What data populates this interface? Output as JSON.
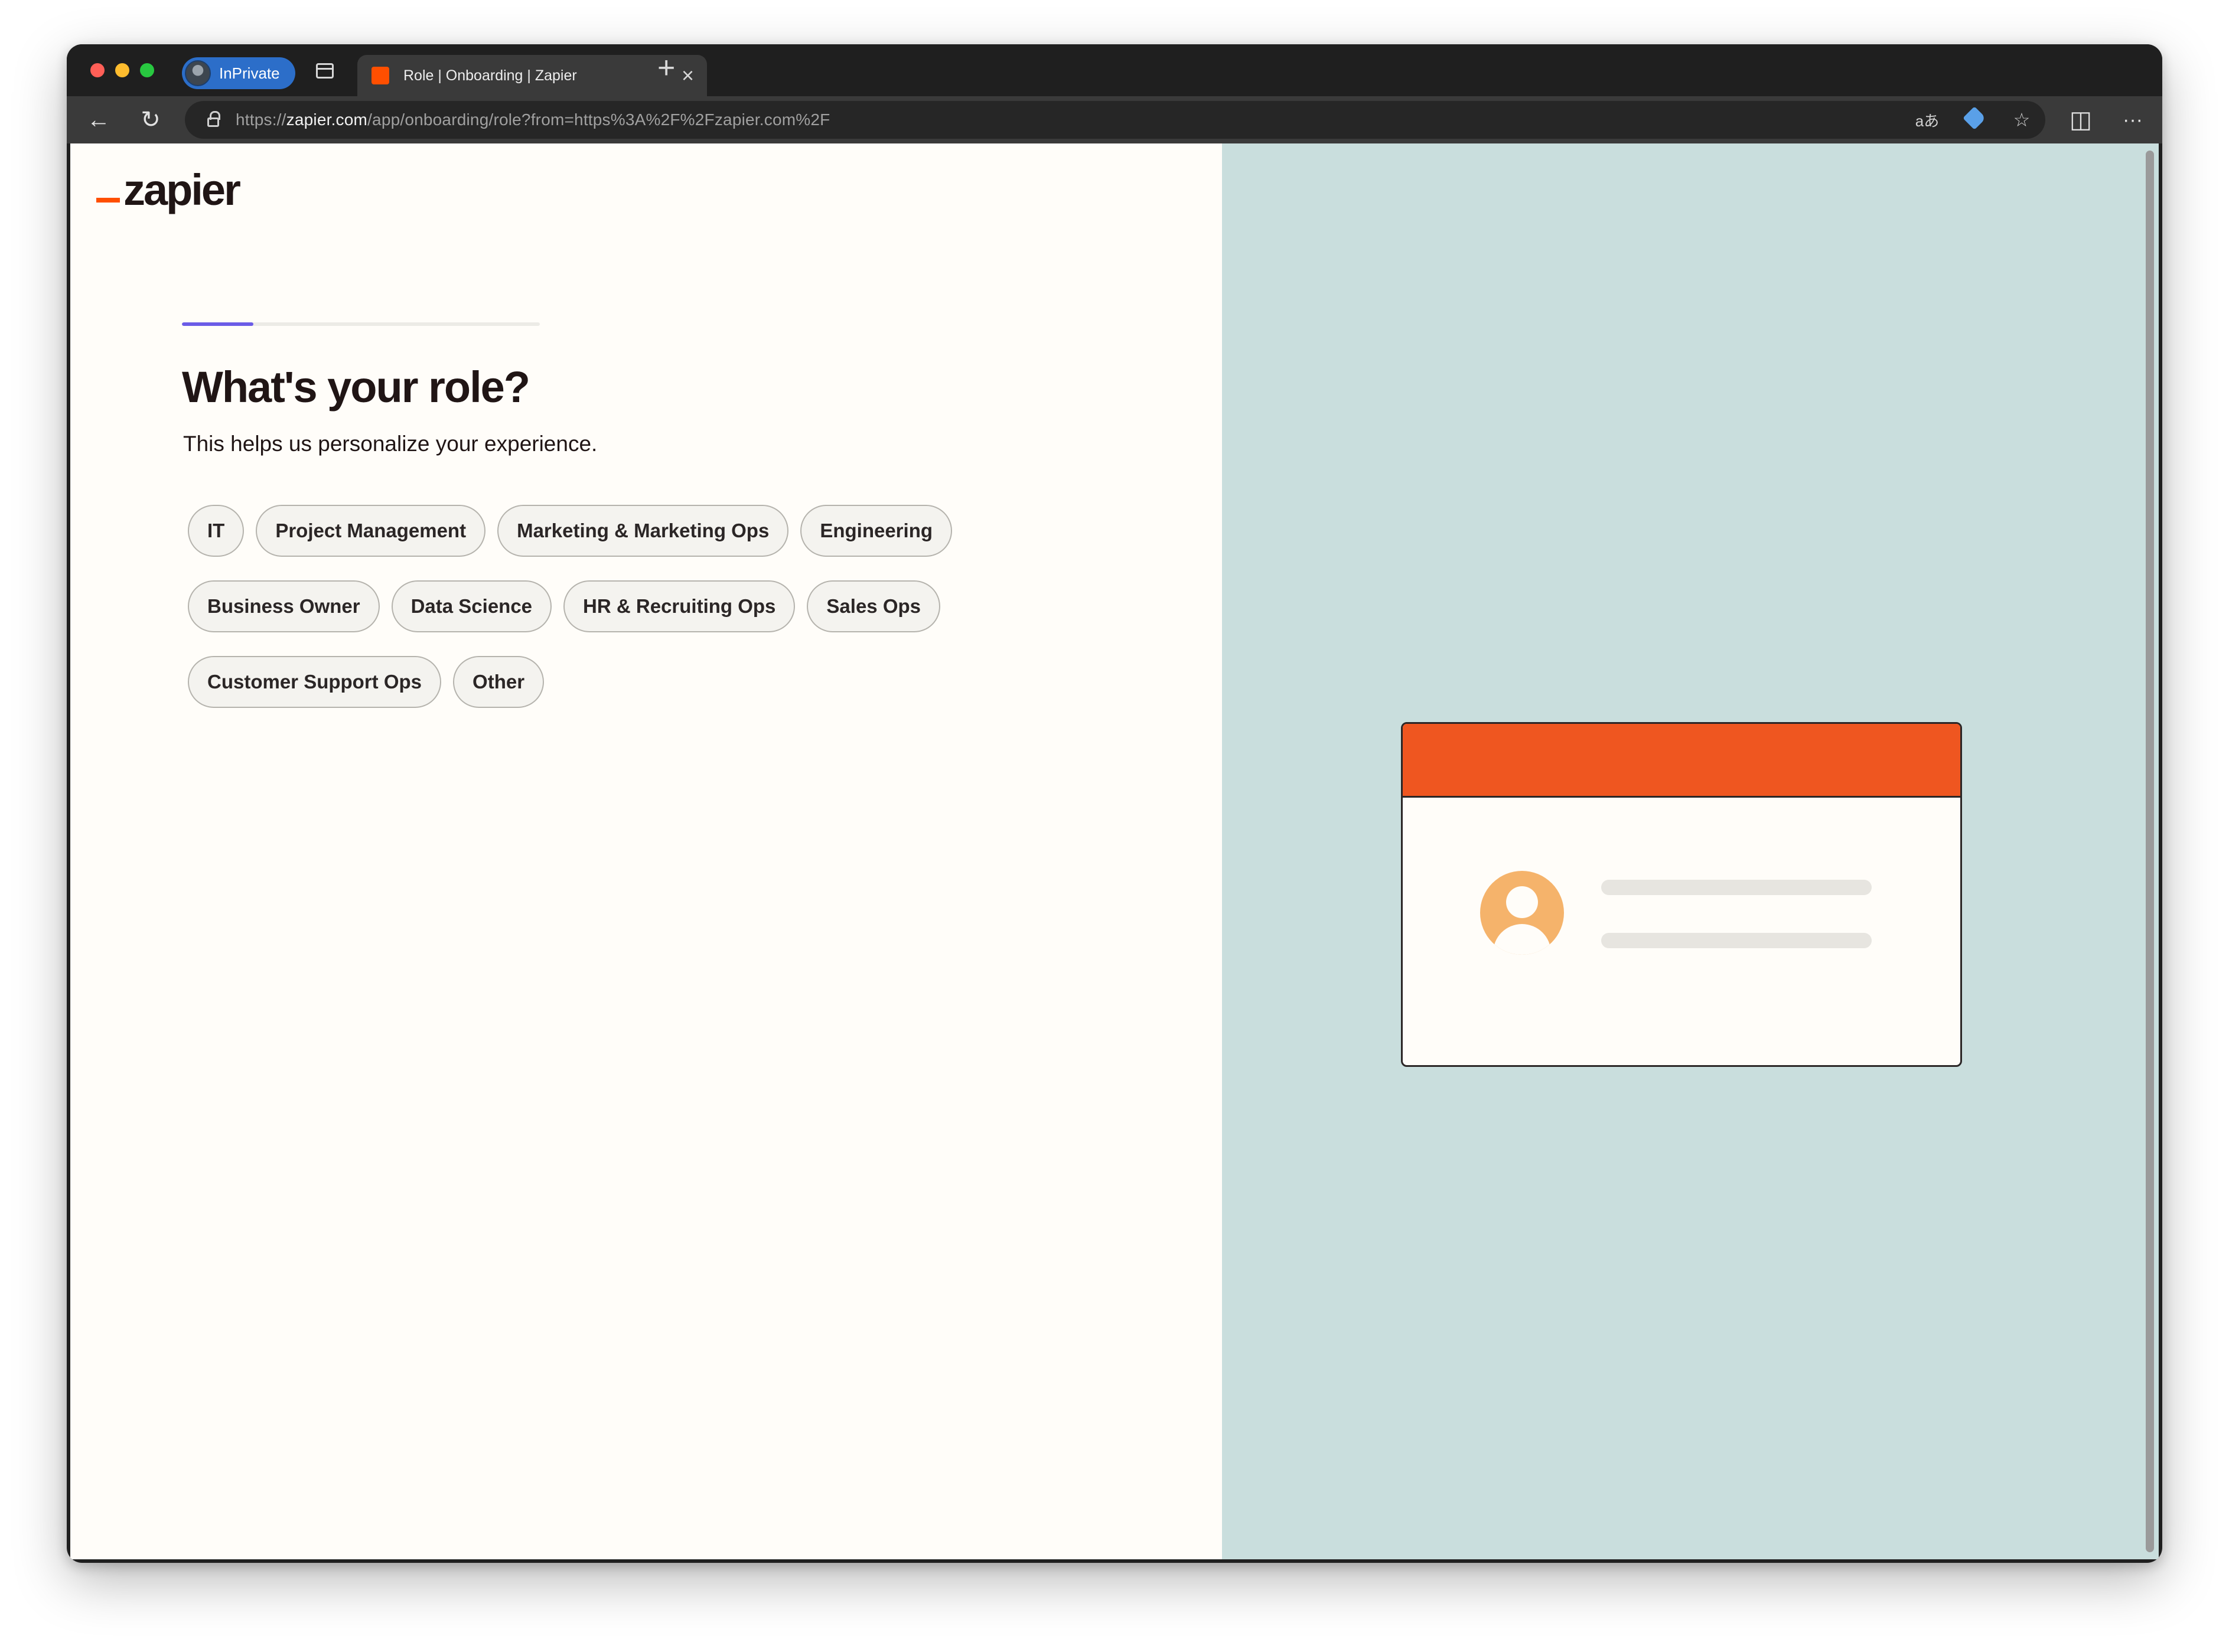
{
  "browser": {
    "profile_label": "InPrivate",
    "tab_title": "Role | Onboarding | Zapier",
    "tab_close_glyph": "×",
    "new_tab_glyph": "+",
    "url_prefix": "https://",
    "url_host": "zapier.com",
    "url_path": "/app/onboarding/role?from=https%3A%2F%2Fzapier.com%2F",
    "back_glyph": "←",
    "reload_glyph": "↻",
    "read_aloud_glyph": "aあ",
    "favorite_glyph": "☆",
    "split_glyph": "◫",
    "more_glyph": "···"
  },
  "page": {
    "logo_text": "zapier",
    "progress_percent": 20,
    "title": "What's your role?",
    "subtitle": "This helps us personalize your experience.",
    "roles_row1": [
      "IT",
      "Project Management",
      "Marketing & Marketing Ops",
      "Engineering"
    ],
    "roles_row2": [
      "Business Owner",
      "Data Science",
      "HR & Recruiting Ops",
      "Sales Ops"
    ],
    "roles_row3": [
      "Customer Support Ops",
      "Other"
    ]
  },
  "colors": {
    "brand_orange": "#ff4f00",
    "progress_fill": "#6b5ce7",
    "right_panel": "#c9dedd",
    "card_header": "#ef5620",
    "avatar": "#f5b36b"
  }
}
